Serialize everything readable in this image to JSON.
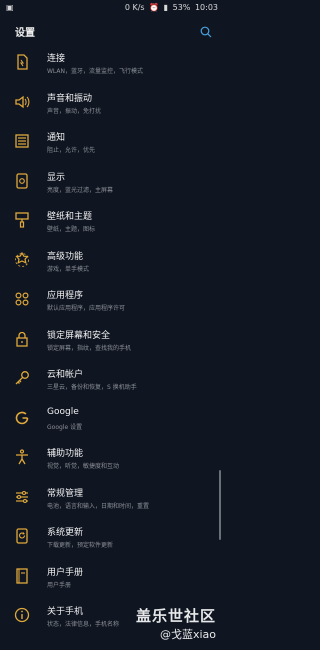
{
  "status_bar": {
    "left_icon": "picture-icon",
    "speed": "0 K/s",
    "battery": "53%",
    "time": "10:03"
  },
  "header": {
    "title": "设置"
  },
  "accent_color": "#e0a93b",
  "items": [
    {
      "icon": "connections-icon",
      "title": "连接",
      "subtitle": "WLAN，蓝牙，流量监控，飞行模式"
    },
    {
      "icon": "sound-icon",
      "title": "声音和振动",
      "subtitle": "声音，振动，免打扰"
    },
    {
      "icon": "notifications-icon",
      "title": "通知",
      "subtitle": "阻止，允许，优先"
    },
    {
      "icon": "display-icon",
      "title": "显示",
      "subtitle": "亮度，蓝光过滤，主屏幕"
    },
    {
      "icon": "wallpaper-theme-icon",
      "title": "壁纸和主题",
      "subtitle": "壁纸，主题，图标"
    },
    {
      "icon": "advanced-features-icon",
      "title": "高级功能",
      "subtitle": "游戏，单手模式"
    },
    {
      "icon": "apps-icon",
      "title": "应用程序",
      "subtitle": "默认应用程序，应用程序许可"
    },
    {
      "icon": "lock-icon",
      "title": "锁定屏幕和安全",
      "subtitle": "锁定屏幕，指纹，查找我的手机"
    },
    {
      "icon": "key-icon",
      "title": "云和帐户",
      "subtitle": "三星云，备份和恢复，S 换机助手"
    },
    {
      "icon": "google-icon",
      "title": "Google",
      "subtitle": "Google 设置"
    },
    {
      "icon": "accessibility-icon",
      "title": "辅助功能",
      "subtitle": "视觉，听觉，敏捷度和互动"
    },
    {
      "icon": "general-management-icon",
      "title": "常规管理",
      "subtitle": "电池，语言和输入，日期和时间，重置"
    },
    {
      "icon": "software-update-icon",
      "title": "系统更新",
      "subtitle": "下载更新，预定软件更新"
    },
    {
      "icon": "user-manual-icon",
      "title": "用户手册",
      "subtitle": "用户手册"
    },
    {
      "icon": "info-icon",
      "title": "关于手机",
      "subtitle": "状态，法律信息，手机名称"
    }
  ],
  "watermark": {
    "line1": "盖乐世社区",
    "line2": "@戈蓝xiao"
  }
}
